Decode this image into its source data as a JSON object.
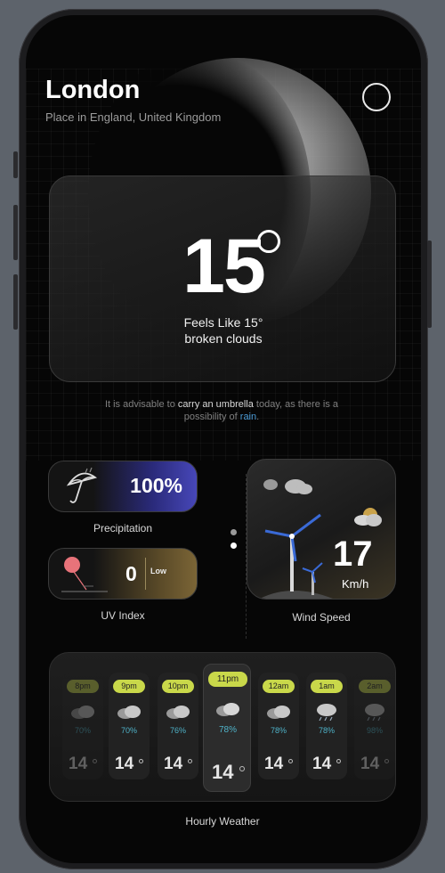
{
  "location": {
    "city": "London",
    "subtitle": "Place in England, United Kingdom"
  },
  "current": {
    "temperature": "15",
    "feels_like": "Feels Like 15°",
    "description": "broken clouds"
  },
  "advice": {
    "part1": "It is advisable to",
    "highlight": "carry an umbrella",
    "part2": "today, as there is a possibility of",
    "rain": "rain",
    "end": "."
  },
  "precipitation": {
    "value": "100%",
    "label": "Precipitation"
  },
  "uv_index": {
    "value": "0",
    "level": "Low",
    "label": "UV Index"
  },
  "wind": {
    "value": "17",
    "unit": "Km/h",
    "label": "Wind Speed"
  },
  "hourly": {
    "label": "Hourly Weather",
    "items": [
      {
        "time": "8pm",
        "pct": "70%",
        "temp": "14"
      },
      {
        "time": "9pm",
        "pct": "70%",
        "temp": "14"
      },
      {
        "time": "10pm",
        "pct": "76%",
        "temp": "14"
      },
      {
        "time": "11pm",
        "pct": "78%",
        "temp": "14"
      },
      {
        "time": "12am",
        "pct": "78%",
        "temp": "14"
      },
      {
        "time": "1am",
        "pct": "78%",
        "temp": "14"
      },
      {
        "time": "2am",
        "pct": "98%",
        "temp": "14"
      }
    ]
  },
  "colors": {
    "accent_lime": "#c9d84a",
    "precip_blue": "#4747b8",
    "uv_gold": "#7b6536",
    "rain_blue": "#4b9bd6"
  },
  "icons": {
    "search": "search-icon",
    "umbrella": "umbrella-icon",
    "sun": "sun-icon",
    "cloud": "cloud-icon",
    "wind_turbine": "wind-turbine-icon"
  }
}
